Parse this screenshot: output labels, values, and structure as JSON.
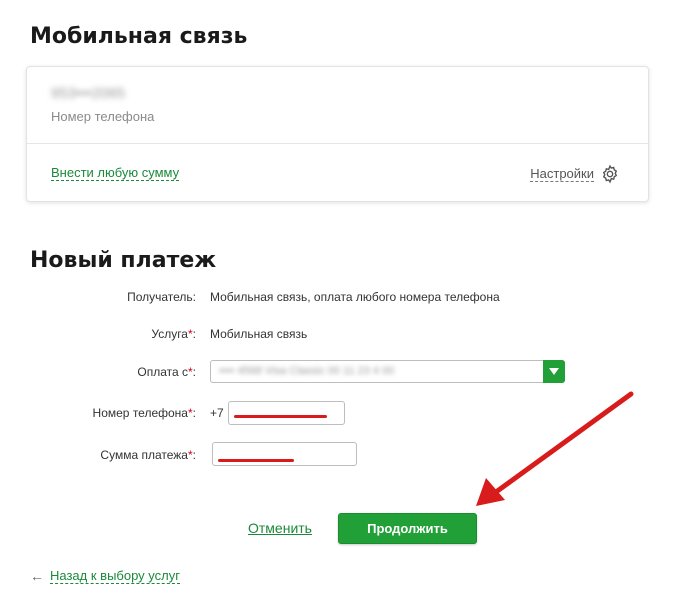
{
  "mobile": {
    "title": "Мобильная связь",
    "phone_masked": "953•••2065",
    "phone_label": "Номер телефона",
    "any_sum_link": "Внести любую сумму",
    "settings_label": "Настройки",
    "settings_icon": "gear-icon"
  },
  "payment": {
    "title": "Новый платеж",
    "recipient_label": "Получатель:",
    "recipient_value": "Мобильная связь, оплата любого номера телефона",
    "service_label": "Услуга",
    "service_value": "Мобильная связь",
    "pay_from_label": "Оплата с",
    "pay_from_value": "•••• 4568 Visa Classic 00 11 23 4 00",
    "phone_label": "Номер телефона",
    "phone_prefix": "+7",
    "phone_value": "",
    "amount_label": "Сумма платежа",
    "amount_value": "",
    "required_mark": "*",
    "colon": ":"
  },
  "actions": {
    "cancel_label": "Отменить",
    "continue_label": "Продолжить",
    "back_label": "Назад к выбору услуг",
    "back_arrow": "←"
  },
  "colors": {
    "accent_green": "#21a038",
    "link_green": "#1a8a3a",
    "required_red": "#d0021b",
    "annotation_red": "#d81b1b"
  }
}
